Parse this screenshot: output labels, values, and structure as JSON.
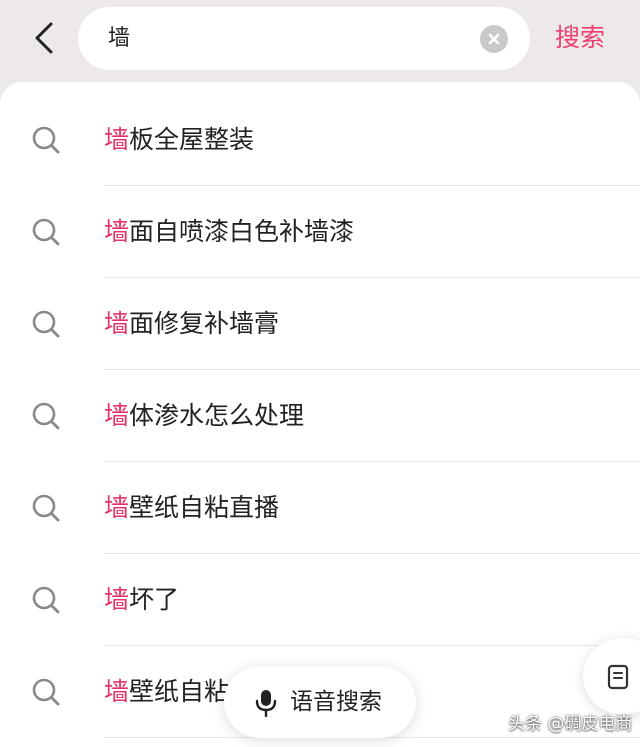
{
  "search": {
    "query": "墙",
    "submit_label": "搜索"
  },
  "suggestions": [
    {
      "highlight": "墙",
      "rest": "板全屋整装"
    },
    {
      "highlight": "墙",
      "rest": "面自喷漆白色补墙漆"
    },
    {
      "highlight": "墙",
      "rest": "面修复补墙膏"
    },
    {
      "highlight": "墙",
      "rest": "体渗水怎么处理"
    },
    {
      "highlight": "墙",
      "rest": "壁纸自粘直播"
    },
    {
      "highlight": "墙",
      "rest": "坏了"
    },
    {
      "highlight": "墙",
      "rest": "壁纸自粘"
    }
  ],
  "voice_search": {
    "label": "语音搜索"
  },
  "watermark": "头条 @碉皮电商",
  "colors": {
    "accent": "#ef3f73",
    "highlight": "#e4356b",
    "background": "#ece9e8"
  },
  "icons": {
    "back": "chevron-left-icon",
    "clear": "clear-icon",
    "suggestion": "search-icon",
    "voice": "microphone-icon",
    "side": "document-icon"
  }
}
